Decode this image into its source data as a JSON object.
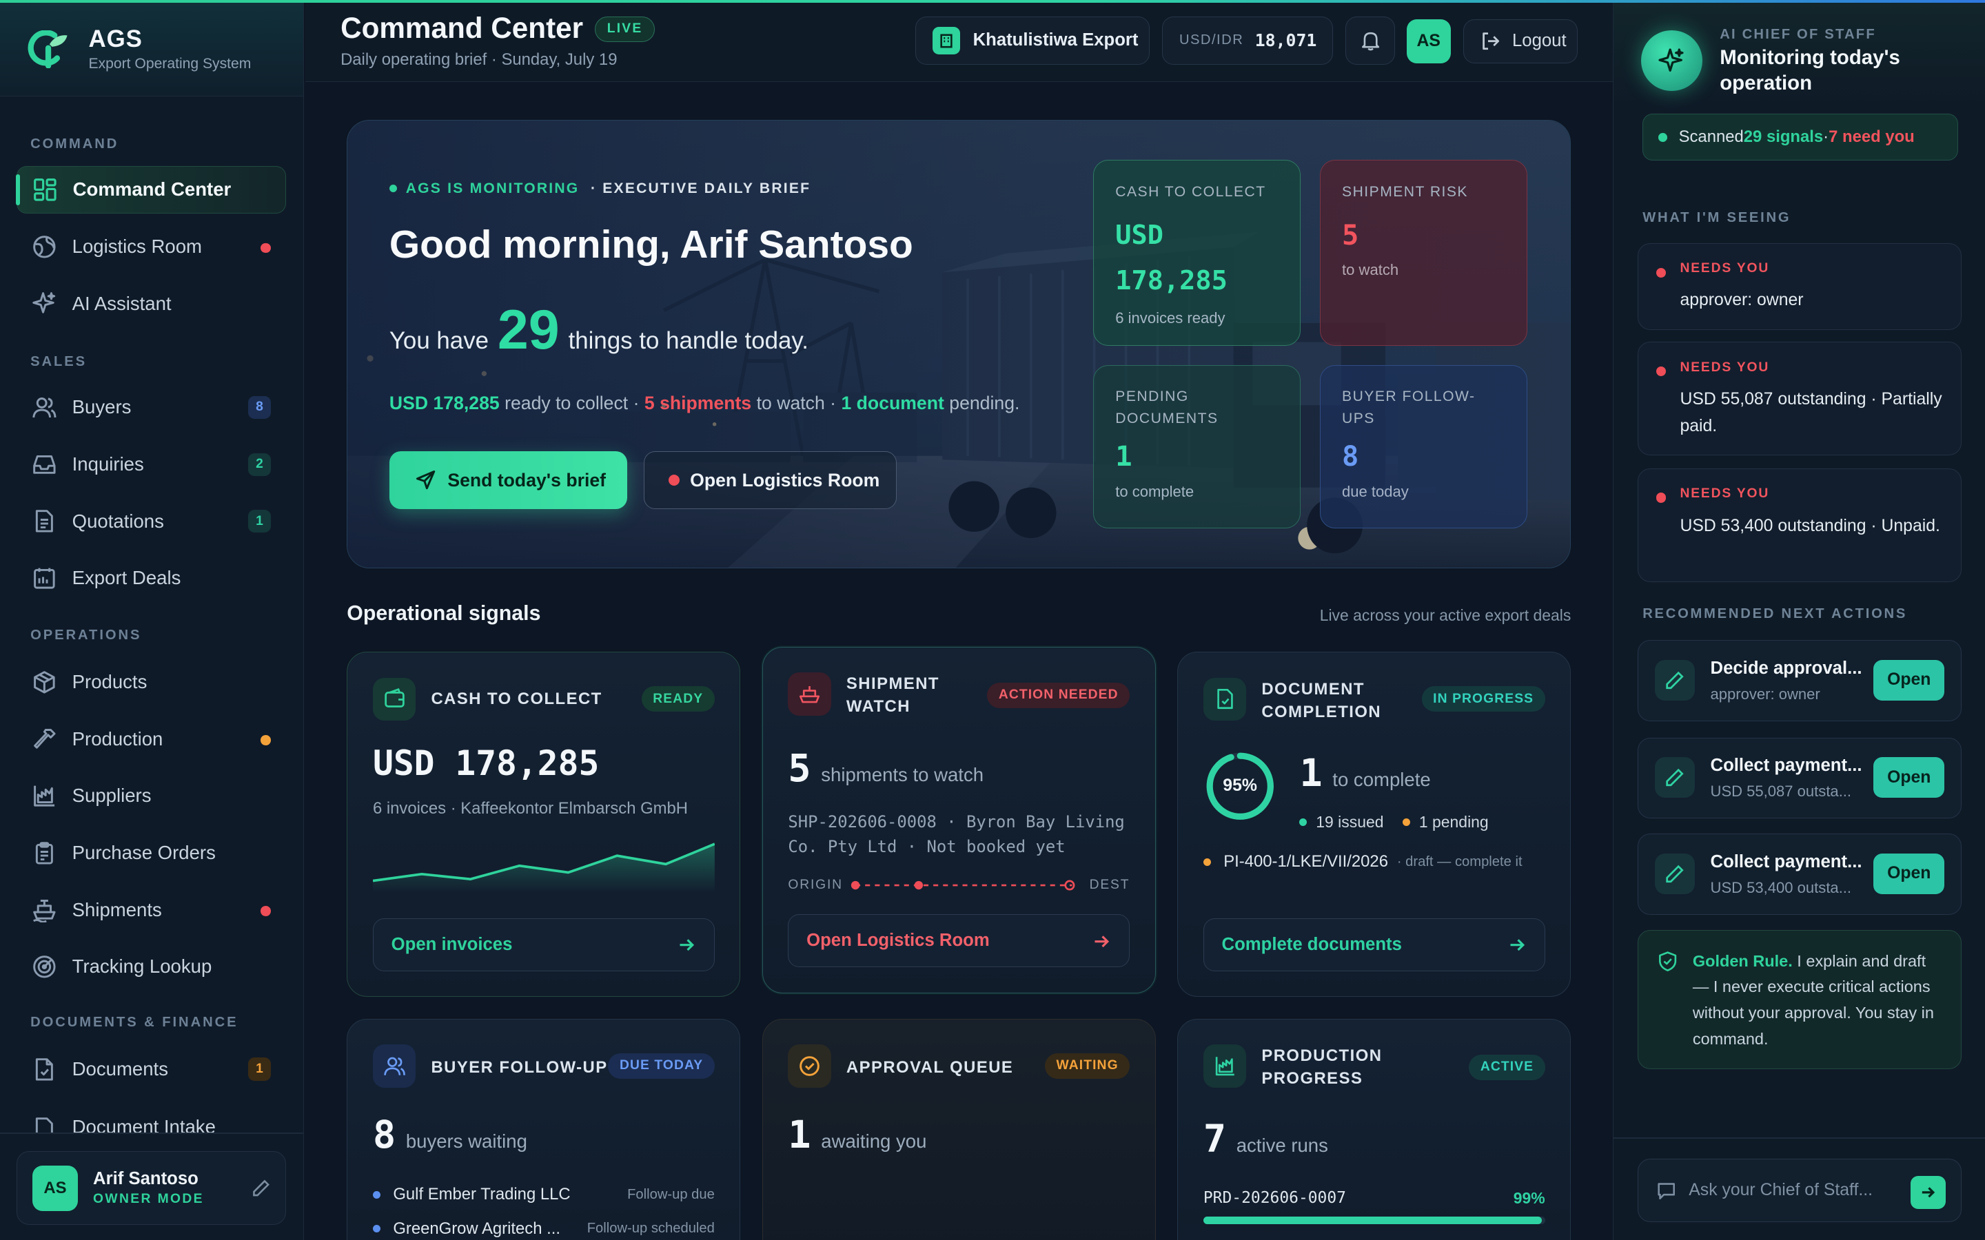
{
  "app": {
    "name": "AGS",
    "subtitle": "Export Operating System"
  },
  "sidebar": {
    "sections": {
      "command": "COMMAND",
      "sales": "SALES",
      "operations": "OPERATIONS",
      "docs": "DOCUMENTS & FINANCE"
    },
    "items": {
      "command_center": "Command Center",
      "logistics_room": "Logistics Room",
      "ai_assistant": "AI Assistant",
      "buyers": "Buyers",
      "buyers_count": "8",
      "inquiries": "Inquiries",
      "inquiries_count": "2",
      "quotations": "Quotations",
      "quotations_count": "1",
      "export_deals": "Export Deals",
      "products": "Products",
      "production": "Production",
      "suppliers": "Suppliers",
      "purchase_orders": "Purchase Orders",
      "shipments": "Shipments",
      "tracking_lookup": "Tracking Lookup",
      "documents": "Documents",
      "documents_count": "1",
      "document_intake": "Document Intake"
    },
    "user": {
      "initials": "AS",
      "name": "Arif Santoso",
      "role": "OWNER MODE"
    }
  },
  "header": {
    "title": "Command Center",
    "live_badge": "LIVE",
    "subtitle": "Daily operating brief · Sunday, July 19",
    "company": "Khatulistiwa Export",
    "fx_label": "USD/IDR",
    "fx_value": "18,071",
    "avatar": "AS",
    "logout": "Logout"
  },
  "hero": {
    "monitoring": "AGS IS MONITORING",
    "brief": "· EXECUTIVE DAILY BRIEF",
    "greeting": "Good morning, Arif Santoso",
    "you_have": "You have",
    "count": "29",
    "things": "things to handle today.",
    "sum_cash": "USD 178,285",
    "sum_cash_t": " ready to collect · ",
    "sum_ship": "5 shipments",
    "sum_ship_t": " to watch · ",
    "sum_doc": "1 document",
    "sum_doc_t": " pending.",
    "send_btn": "Send today's brief",
    "logistics_btn": "Open Logistics Room",
    "stats": {
      "cash": {
        "label": "CASH TO COLLECT",
        "value": "USD 178,285",
        "sub": "6 invoices ready"
      },
      "risk": {
        "label": "SHIPMENT RISK",
        "value": "5",
        "sub": "to watch"
      },
      "docs": {
        "label": "PENDING DOCUMENTS",
        "value": "1",
        "sub": "to complete"
      },
      "follow": {
        "label": "BUYER FOLLOW-UPS",
        "value": "8",
        "sub": "due today"
      }
    }
  },
  "signals": {
    "title": "Operational signals",
    "note": "Live across your active export deals",
    "cash": {
      "title": "CASH TO COLLECT",
      "badge": "READY",
      "value": "USD 178,285",
      "sub": "6 invoices · Kaffeekontor Elmbarsch GmbH",
      "btn": "Open invoices",
      "trend": [
        30,
        34,
        31,
        39,
        35,
        45,
        40,
        52
      ]
    },
    "shipment": {
      "title": "SHIPMENT WATCH",
      "badge": "ACTION NEEDED",
      "count": "5",
      "count_label": "shipments to watch",
      "detail": "SHP-202606-0008 · Byron Bay Living Co. Pty Ltd · Not booked yet",
      "origin": "ORIGIN",
      "dest": "DEST",
      "btn": "Open Logistics Room"
    },
    "documents": {
      "title": "DOCUMENT COMPLETION",
      "badge": "IN PROGRESS",
      "percent": "95%",
      "percent_value": 95,
      "count": "1",
      "count_label": "to complete",
      "issued": "19 issued",
      "pending": "1 pending",
      "doc_id": "PI-400-1/LKE/VII/2026",
      "doc_note": "· draft — complete it",
      "btn": "Complete documents"
    },
    "buyer": {
      "title": "BUYER FOLLOW-UP",
      "badge": "DUE TODAY",
      "count": "8",
      "count_label": "buyers waiting",
      "rows": [
        {
          "name": "Gulf Ember Trading LLC",
          "status": "Follow-up due"
        },
        {
          "name": "GreenGrow Agritech ...",
          "status": "Follow-up scheduled"
        }
      ]
    },
    "approval": {
      "title": "APPROVAL QUEUE",
      "badge": "WAITING",
      "count": "1",
      "count_label": "awaiting you"
    },
    "production": {
      "title": "PRODUCTION PROGRESS",
      "badge": "ACTIVE",
      "count": "7",
      "count_label": "active runs",
      "run_id": "PRD-202606-0007",
      "run_pct": "99%",
      "run_value": 99
    }
  },
  "assistant": {
    "role": "AI CHIEF OF STAFF",
    "status": "Monitoring today's operation",
    "scanned_pre": "Scanned ",
    "scanned_signals": "29 signals",
    "scanned_sep": " · ",
    "scanned_need": "7 need you",
    "seeing_title": "WHAT I'M SEEING",
    "needs": [
      {
        "tag": "NEEDS YOU",
        "text": "approver: owner"
      },
      {
        "tag": "NEEDS YOU",
        "text": "USD 55,087 outstanding · Partially paid."
      },
      {
        "tag": "NEEDS YOU",
        "text": "USD 53,400 outstanding · Unpaid."
      }
    ],
    "actions_title": "RECOMMENDED NEXT ACTIONS",
    "actions": [
      {
        "title": "Decide approval...",
        "sub": "approver: owner",
        "btn": "Open"
      },
      {
        "title": "Collect payment...",
        "sub": "USD 55,087 outsta...",
        "btn": "Open"
      },
      {
        "title": "Collect payment...",
        "sub": "USD 53,400 outsta...",
        "btn": "Open"
      }
    ],
    "rule_title": "Golden Rule.",
    "rule_text": " I explain and draft — I never execute critical actions without your approval. You stay in command.",
    "ask_placeholder": "Ask your Chief of Staff..."
  },
  "colors": {
    "accent": "#2fd39c",
    "danger": "#ef4d57",
    "warning": "#f4a23a",
    "info": "#5b8ff0"
  }
}
